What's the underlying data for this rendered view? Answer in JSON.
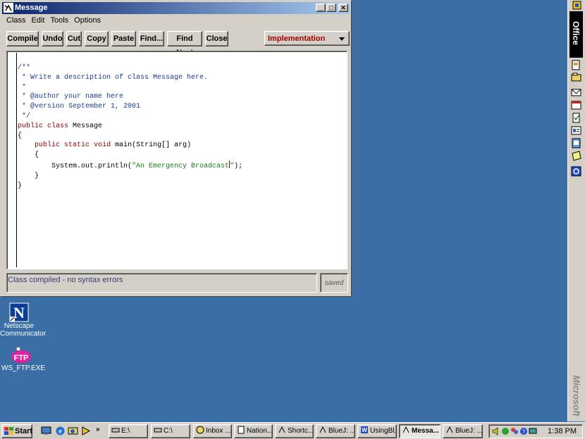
{
  "window": {
    "title": "Message",
    "menu": [
      "Class",
      "Edit",
      "Tools",
      "Options"
    ],
    "toolbar": {
      "compile": "Compile",
      "undo": "Undo",
      "cut": "Cut",
      "copy": "Copy",
      "paste": "Paste",
      "find": "Find...",
      "find_next": "Find Next",
      "close": "Close"
    },
    "view_select": "Implementation",
    "code_lines": [
      "/**",
      " * Write a description of class Message here.",
      " *",
      " * @author your name here",
      " * @version September 1, 2001",
      " */",
      "public class Message",
      "{",
      "    public static void main(String[] arg)",
      "    {",
      "        System.out.println(\"An Emergency Broadcast\");",
      "    }",
      "}"
    ],
    "status": "Class compiled - no syntax errors",
    "saved": "saved"
  },
  "desktop": {
    "icons": [
      {
        "label_line1": "Netscape",
        "label_line2": "Communicator",
        "icon": "netscape-icon"
      },
      {
        "label_line1": "WS_FTP.EXE",
        "label_line2": "",
        "icon": "ftp-icon"
      }
    ]
  },
  "office_bar": {
    "title": "Office",
    "brand": "Microsoft"
  },
  "taskbar": {
    "start": "Start",
    "tasks": [
      "E:\\",
      "C:\\",
      "Inbox ...",
      "Nation...",
      "Shortc...",
      "BlueJ: ...",
      "UsingBl...",
      "Messa...",
      "BlueJ: ..."
    ],
    "active_task": "Messa...",
    "clock": "1:38 PM"
  },
  "colors": {
    "desktop": "#3a6ea5",
    "title_start": "#0a246a",
    "title_end": "#a6caf0",
    "keyword": "#8b0000",
    "comment": "#1a3a8a",
    "string": "#1a7a1a"
  }
}
